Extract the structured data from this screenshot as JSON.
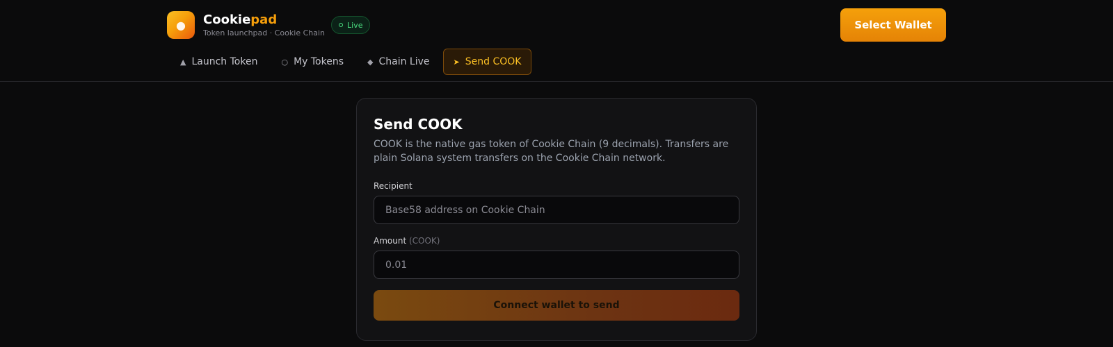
{
  "brand": {
    "name_main": "Cookie",
    "name_accent": "pad",
    "subtitle": "Token launchpad · Cookie Chain",
    "logo_icon": "cookie-icon",
    "live_label": "Live"
  },
  "header": {
    "wallet_button": "Select Wallet"
  },
  "nav": {
    "items": [
      {
        "label": "Launch Token",
        "icon": "rocket-icon",
        "active": false
      },
      {
        "label": "My Tokens",
        "icon": "coins-icon",
        "active": false
      },
      {
        "label": "Chain Live",
        "icon": "activity-icon",
        "active": false
      },
      {
        "label": "Send COOK",
        "icon": "send-icon",
        "active": true
      }
    ]
  },
  "send": {
    "title": "Send COOK",
    "description": "COOK is the native gas token of Cookie Chain (9 decimals). Transfers are plain Solana system transfers on the Cookie Chain network.",
    "recipient_label": "Recipient",
    "recipient_placeholder": "Base58 address on Cookie Chain",
    "amount_label": "Amount",
    "amount_unit": "(COOK)",
    "amount_placeholder": "0.01",
    "submit_label": "Connect wallet to send"
  },
  "colors": {
    "accent": "#f59e0b",
    "live": "#4ade80",
    "background": "#0b0b0c"
  }
}
